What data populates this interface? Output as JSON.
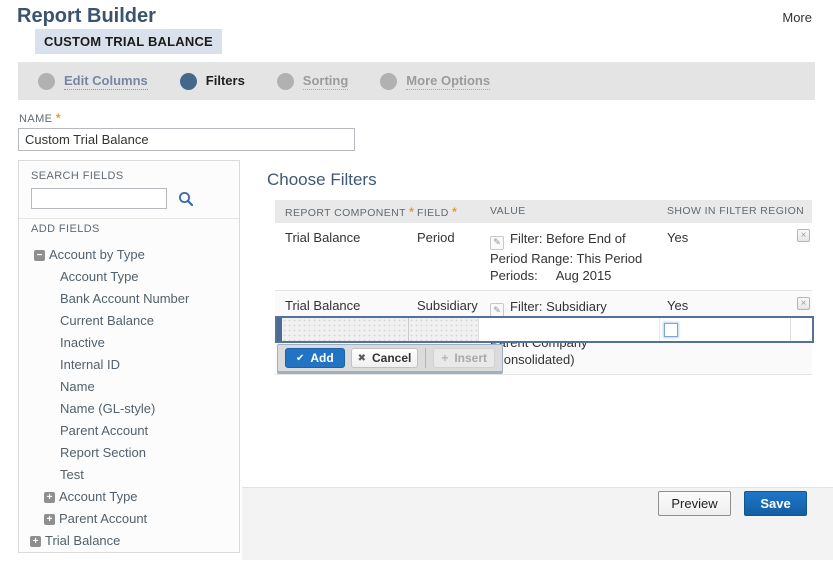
{
  "page": {
    "title": "Report Builder",
    "more_label": "More",
    "subtitle": "CUSTOM TRIAL BALANCE"
  },
  "nav": {
    "steps": [
      {
        "label": "Edit Columns",
        "state": "visited"
      },
      {
        "label": "Filters",
        "state": "active"
      },
      {
        "label": "Sorting",
        "state": "default"
      },
      {
        "label": "More Options",
        "state": "default"
      }
    ]
  },
  "name_field": {
    "label": "NAME",
    "required": "*",
    "value": "Custom Trial Balance"
  },
  "sidebar": {
    "search_label": "SEARCH FIELDS",
    "search_value": "",
    "add_fields_label": "ADD FIELDS",
    "tree": [
      {
        "label": "Account by Type",
        "toggle": "minus"
      },
      {
        "label": "Account Type"
      },
      {
        "label": "Bank Account Number"
      },
      {
        "label": "Current Balance"
      },
      {
        "label": "Inactive"
      },
      {
        "label": "Internal ID"
      },
      {
        "label": "Name"
      },
      {
        "label": "Name (GL-style)"
      },
      {
        "label": "Parent Account"
      },
      {
        "label": "Report Section"
      },
      {
        "label": "Test"
      },
      {
        "label": "Account Type",
        "toggle": "plus"
      },
      {
        "label": "Parent Account",
        "toggle": "plus"
      },
      {
        "label": "Trial Balance",
        "toggle": "plus"
      }
    ]
  },
  "filters": {
    "heading": "Choose Filters",
    "columns": {
      "component": "REPORT COMPONENT",
      "field": "FIELD",
      "value": "VALUE",
      "show": "SHOW IN FILTER REGION",
      "required": "*"
    },
    "rows": [
      {
        "component": "Trial Balance",
        "field": "Period",
        "value_lines": [
          "Filter: Before End of",
          "Period Range: This Period",
          "Periods:     Aug 2015"
        ],
        "show": "Yes"
      },
      {
        "component": "Trial Balance",
        "field": "Subsidiary",
        "value_lines": [
          "Filter: Subsidiary Context",
          "Parent Company (Consolidated)"
        ],
        "show": "Yes"
      }
    ]
  },
  "edit_bar": {
    "add": "Add",
    "cancel": "Cancel",
    "insert": "Insert"
  },
  "footer": {
    "preview": "Preview",
    "save": "Save"
  },
  "icons": {
    "check": "✔",
    "cross": "✖",
    "plus": "+",
    "minus": "−",
    "pencil": "✎",
    "delete": "×"
  },
  "colors": {
    "accent_blue": "#2273c3",
    "active_step_blue": "#44688c",
    "save_blue": "#135fa4",
    "chip_bg": "#d9e2ec",
    "edit_row_border": "#54719b",
    "required_star": "#e39b2d"
  }
}
